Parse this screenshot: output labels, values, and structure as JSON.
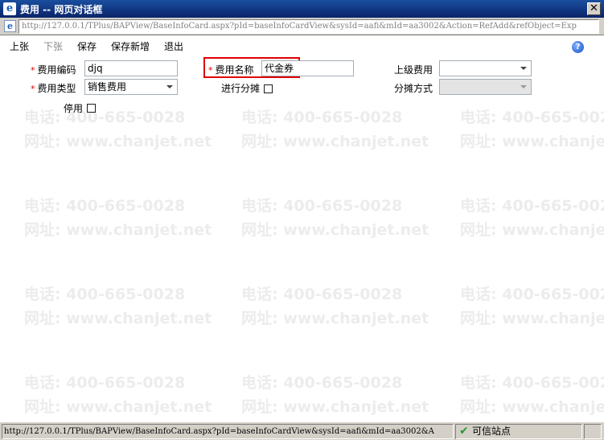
{
  "window": {
    "title": "费用 -- 网页对话框",
    "close_glyph": "✕",
    "ie_glyph": "e"
  },
  "address": {
    "url": "http://127.0.0.1/TPlus/BAPView/BaseInfoCard.aspx?pId=baseInfoCardView&sysId=aafi&mId=aa3002&Action=RefAdd&refObject=Exp"
  },
  "toolbar": {
    "prev_label": "上张",
    "next_label": "下张",
    "save_label": "保存",
    "save_new_label": "保存新增",
    "exit_label": "退出",
    "help_glyph": "?"
  },
  "form": {
    "required_mark": "*",
    "code_label": "费用编码",
    "code_value": "djq",
    "name_label": "费用名称",
    "name_value": "代金券",
    "parent_label": "上级费用",
    "parent_value": "",
    "type_label": "费用类型",
    "type_value": "销售费用",
    "allocate_label": "进行分摊",
    "allocate_checked": false,
    "alloc_method_label": "分摊方式",
    "alloc_method_value": "",
    "disabled_label": "停用",
    "disabled_checked": false
  },
  "watermark": {
    "phone": "电话: 400-665-0028",
    "site": "网址: www.chanjet.net"
  },
  "status": {
    "url": "http://127.0.0.1/TPlus/BAPView/BaseInfoCard.aspx?pId=baseInfoCardView&sysId=aafi&mId=aa3002&A",
    "zone_label": "可信站点",
    "zone_icon_glyph": "✔"
  },
  "colors": {
    "title_bar": "#0a246a",
    "highlight": "#e00000",
    "required": "#e00000"
  }
}
